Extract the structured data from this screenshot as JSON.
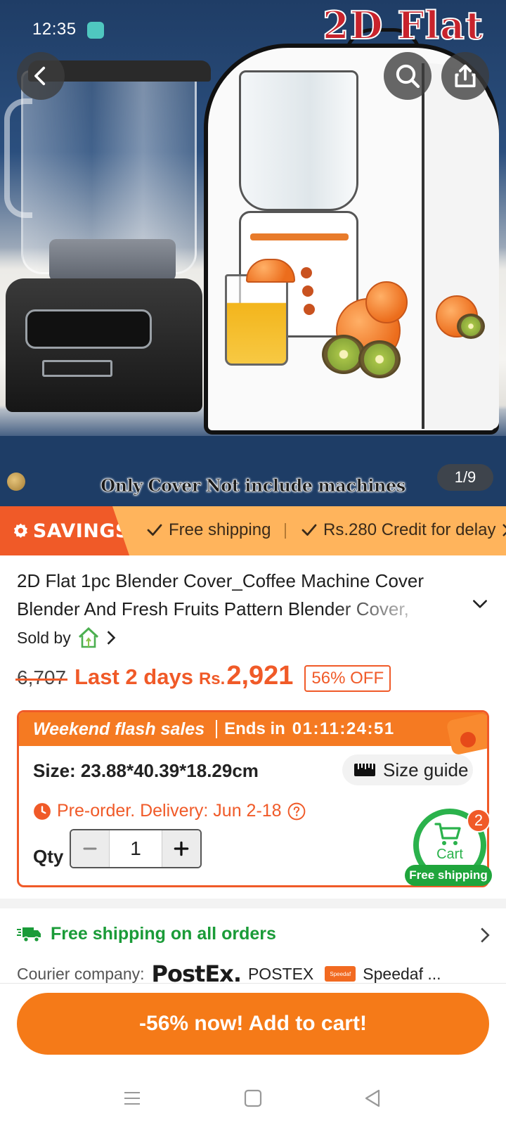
{
  "status_bar": {
    "time": "12:35"
  },
  "hero": {
    "brand_overlay": "2D Flat",
    "caption": "Only Cover Not include machines",
    "image_counter": "1/9",
    "icons": {
      "back": "chevron-left-icon",
      "search": "search-icon",
      "share": "share-icon"
    }
  },
  "savings": {
    "tag": "SAVINGS",
    "items": [
      "Free shipping",
      "Rs.280 Credit for delay"
    ]
  },
  "product": {
    "title": "2D Flat 1pc Blender Cover_Coffee Machine Cover Blender And Fresh Fruits Pattern Blender Cover,",
    "sold_by_label": "Sold by"
  },
  "price": {
    "original": "6,707",
    "urgency": "Last 2 days",
    "currency": "Rs.",
    "current": "2,921",
    "discount_badge": "56% OFF"
  },
  "flash_sale": {
    "title": "Weekend flash sales",
    "ends_label": "Ends in",
    "timer": "01:11:24:51",
    "size_text": "Size: 23.88*40.39*18.29cm",
    "size_guide_label": "Size guide",
    "preorder_text": "Pre-order. Delivery: Jun 2-18",
    "qty_label": "Qty",
    "qty_value": "1"
  },
  "cart_fab": {
    "label": "Cart",
    "count": "2",
    "free_shipping": "Free shipping"
  },
  "shipping": {
    "headline": "Free shipping on all orders",
    "courier_label": "Courier company:",
    "courier_logo_1": "PostEx.",
    "courier_name_1": "POSTEX",
    "courier_logo_2": "Speedaf",
    "courier_name_2": "Speedaf ..."
  },
  "cta": {
    "label": "-56% now! Add to cart!"
  },
  "colors": {
    "accent": "#f05a28",
    "savings_bg": "#ffb45c",
    "shipping_green": "#1a9b38",
    "cta_orange": "#f57a18"
  }
}
